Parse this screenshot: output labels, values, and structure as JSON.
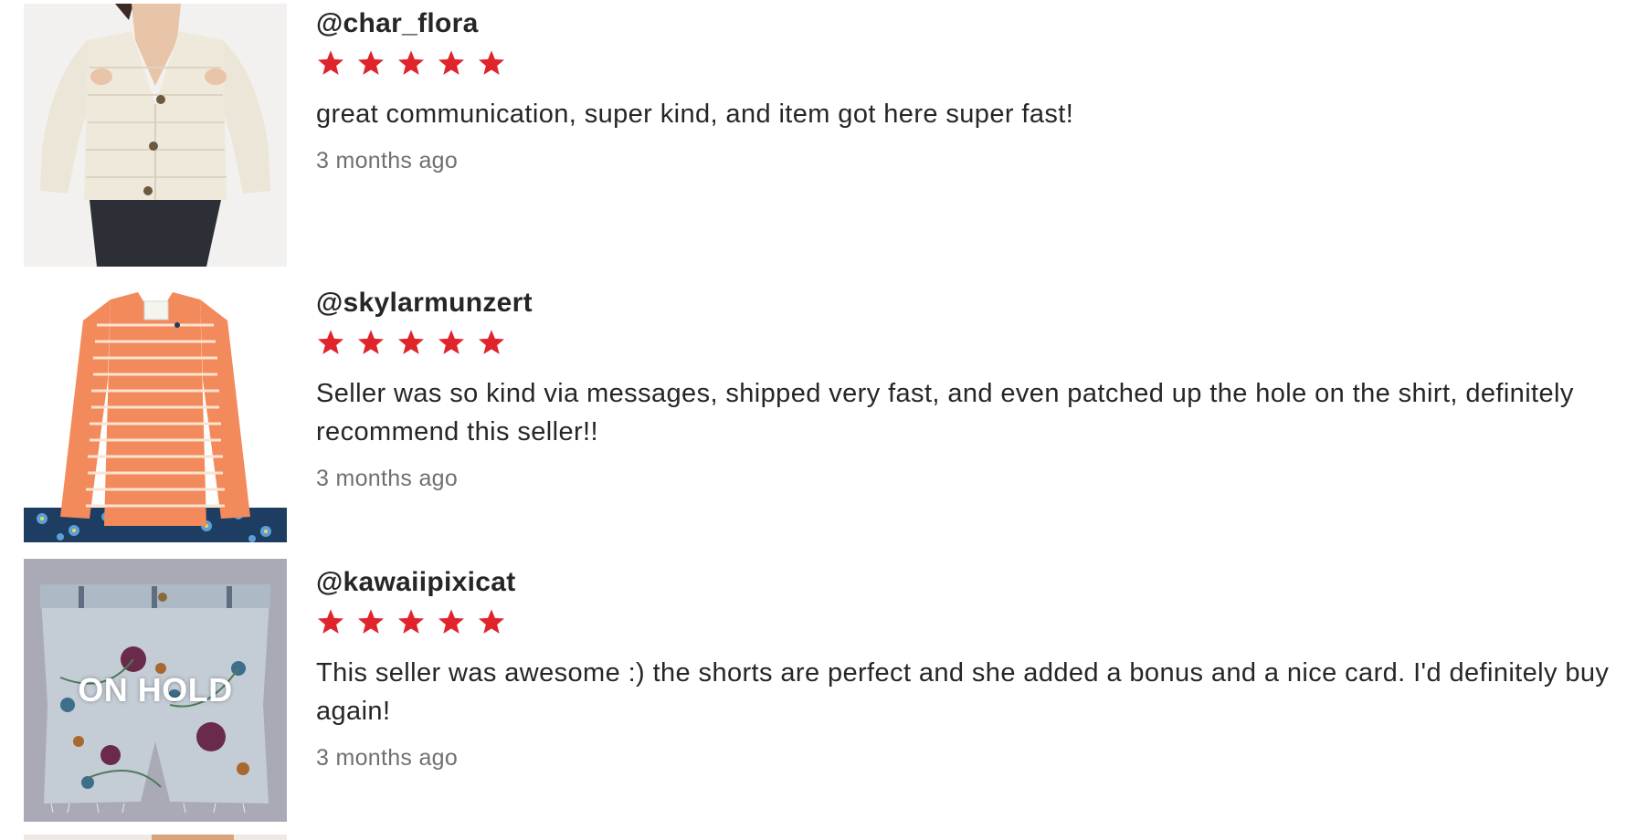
{
  "reviews": [
    {
      "username": "@char_flora",
      "rating": 5,
      "max_rating": 5,
      "text": "great communication, super kind, and item got here super fast!",
      "date": "3 months ago",
      "item_image": "cream-knit-cardigan-photo"
    },
    {
      "username": "@skylarmunzert",
      "rating": 5,
      "max_rating": 5,
      "text": "Seller was so kind via messages, shipped very fast, and even patched up the hole on the shirt, definitely recommend this seller!!",
      "date": "3 months ago",
      "item_image": "orange-striped-long-sleeve-photo"
    },
    {
      "username": "@kawaiipixicat",
      "rating": 5,
      "max_rating": 5,
      "text": "This seller was awesome :) the shorts are perfect and she added a bonus and a nice card. I'd definitely buy again!",
      "date": "3 months ago",
      "item_image": "embroidered-denim-shorts-photo",
      "overlay_label": "ON HOLD"
    }
  ],
  "colors": {
    "star": "#e0242b",
    "username": "#262626",
    "text": "#262626",
    "date": "#707070"
  }
}
